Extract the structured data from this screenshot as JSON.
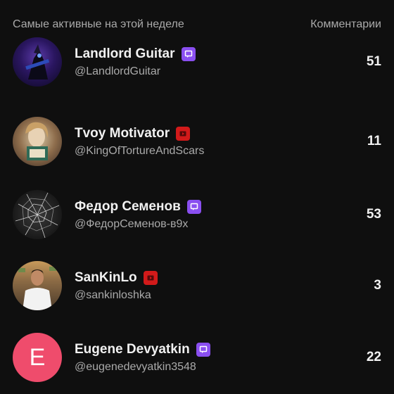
{
  "header": {
    "title": "Самые активные на этой неделе",
    "column_label": "Комментарии"
  },
  "colors": {
    "member_badge": "#8a4ff0",
    "youtube_badge": "#d21a1a",
    "letter_avatar": "#ef4c6c"
  },
  "users": [
    {
      "name": "Landlord Guitar",
      "handle": "@LandlordGuitar",
      "count": "51",
      "badge": "member-badge-icon",
      "avatar_letter": ""
    },
    {
      "name": "Tvoy Motivator",
      "handle": "@KingOfTortureAndScars",
      "count": "11",
      "badge": "youtube-badge-icon",
      "avatar_letter": ""
    },
    {
      "name": "Федор Семенов",
      "handle": "@ФедорСеменов-в9х",
      "count": "53",
      "badge": "member-badge-icon",
      "avatar_letter": ""
    },
    {
      "name": "SanKinLo",
      "handle": "@sankinloshka",
      "count": "3",
      "badge": "youtube-badge-icon",
      "avatar_letter": ""
    },
    {
      "name": "Eugene Devyatkin",
      "handle": "@eugenedevyatkin3548",
      "count": "22",
      "badge": "member-badge-icon",
      "avatar_letter": "E"
    }
  ]
}
